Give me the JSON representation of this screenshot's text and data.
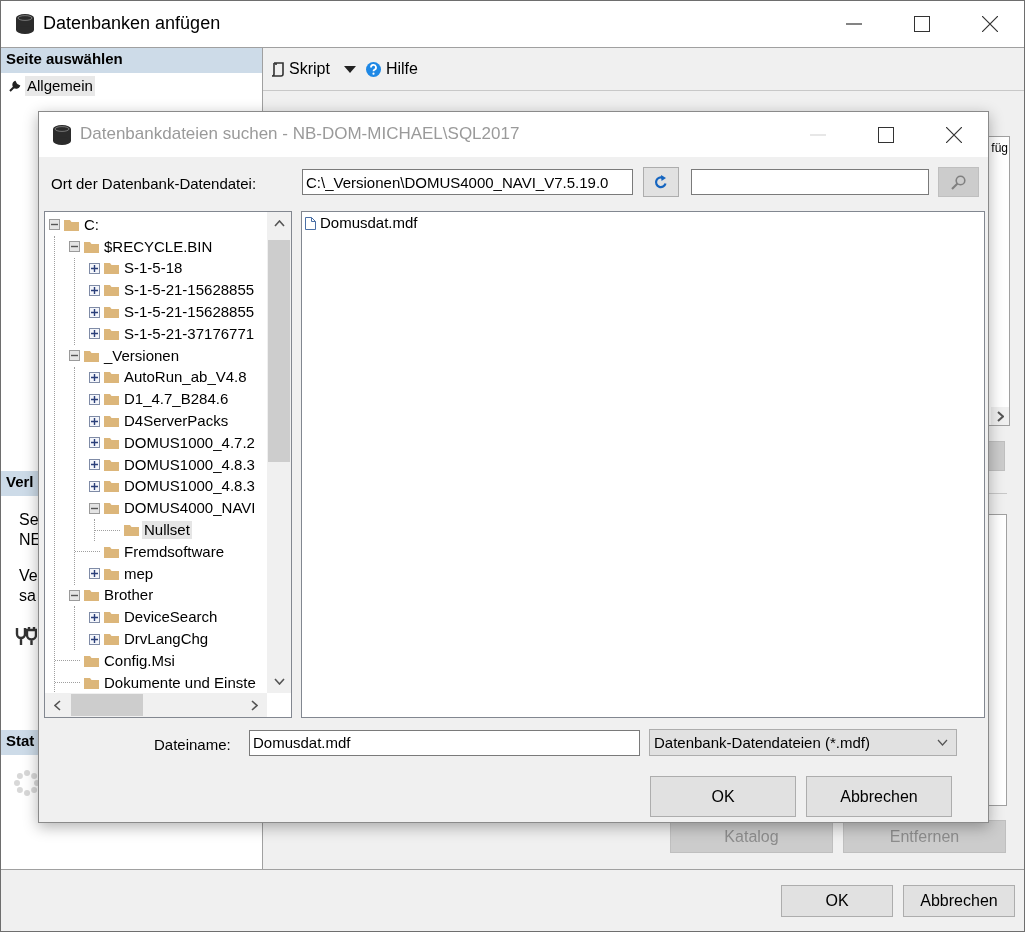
{
  "window": {
    "title": "Datenbanken anfügen"
  },
  "sidebar": {
    "header": "Seite auswählen",
    "items": [
      {
        "label": "Allgemein",
        "selected": true
      }
    ]
  },
  "connection": {
    "header": "Verl",
    "lines": [
      "Se",
      "NE",
      "Ve",
      "sa"
    ]
  },
  "status": {
    "header": "Stat"
  },
  "toolbar": {
    "script_label": "Skript",
    "help_label": "Hilfe"
  },
  "grid": {
    "column_header": "füg"
  },
  "side_buttons": [
    {
      "label": "Katalog",
      "disabled": true
    },
    {
      "label": "Entfernen",
      "disabled": true
    }
  ],
  "buttons": [
    "OK",
    "Abbrechen"
  ],
  "dialog": {
    "title": "Datenbankdateien suchen - NB-DOM-MICHAEL\\SQL2017",
    "location_label": "Ort der Datenbank-Datendatei:",
    "location_value": "C:\\_Versionen\\DOMUS4000_NAVI_V7.5.19.0",
    "search_button": {
      "disabled": true
    },
    "tree": [
      {
        "label": "C:",
        "kind": "folder",
        "expanded": true,
        "selected": false,
        "children": [
          {
            "label": "$RECYCLE.BIN",
            "kind": "folder",
            "expanded": true,
            "selected": false,
            "children": [
              {
                "label": "S-1-5-18",
                "kind": "folder",
                "expanded": false,
                "selected": false
              },
              {
                "label": "S-1-5-21-15628855",
                "kind": "folder",
                "expanded": false,
                "selected": false
              },
              {
                "label": "S-1-5-21-15628855",
                "kind": "folder",
                "expanded": false,
                "selected": false
              },
              {
                "label": "S-1-5-21-37176771",
                "kind": "folder",
                "expanded": false,
                "selected": false
              }
            ]
          },
          {
            "label": "_Versionen",
            "kind": "folder",
            "expanded": true,
            "selected": false,
            "children": [
              {
                "label": "AutoRun_ab_V4.8",
                "kind": "folder",
                "expanded": false,
                "selected": false
              },
              {
                "label": "D1_4.7_B284.6",
                "kind": "folder",
                "expanded": false,
                "selected": false
              },
              {
                "label": "D4ServerPacks",
                "kind": "folder",
                "expanded": false,
                "selected": false
              },
              {
                "label": "DOMUS1000_4.7.2",
                "kind": "folder",
                "expanded": false,
                "selected": false
              },
              {
                "label": "DOMUS1000_4.8.3",
                "kind": "folder",
                "expanded": false,
                "selected": false
              },
              {
                "label": "DOMUS1000_4.8.3",
                "kind": "folder",
                "expanded": false,
                "selected": false
              },
              {
                "label": "DOMUS4000_NAVI",
                "kind": "folder",
                "expanded": true,
                "selected": false,
                "children": [
                  {
                    "label": "Nullset",
                    "kind": "leaf",
                    "selected": true
                  }
                ]
              },
              {
                "label": "Fremdsoftware",
                "kind": "leaf",
                "selected": false
              },
              {
                "label": "mep",
                "kind": "folder",
                "expanded": false,
                "selected": false
              }
            ]
          },
          {
            "label": "Brother",
            "kind": "folder",
            "expanded": true,
            "selected": false,
            "children": [
              {
                "label": "DeviceSearch",
                "kind": "folder",
                "expanded": false,
                "selected": false
              },
              {
                "label": "DrvLangChg",
                "kind": "folder",
                "expanded": false,
                "selected": false
              }
            ]
          },
          {
            "label": "Config.Msi",
            "kind": "leaf",
            "selected": false
          },
          {
            "label": "Dokumente und Einste",
            "kind": "leaf",
            "selected": false
          }
        ]
      }
    ],
    "files": [
      {
        "name": "Domusdat.mdf",
        "selected": false
      }
    ],
    "filename_label": "Dateiname:",
    "filename_value": "Domusdat.mdf",
    "filetype": "Datenbank-Datendateien (*.mdf)",
    "buttons": [
      "OK",
      "Abbrechen"
    ]
  }
}
